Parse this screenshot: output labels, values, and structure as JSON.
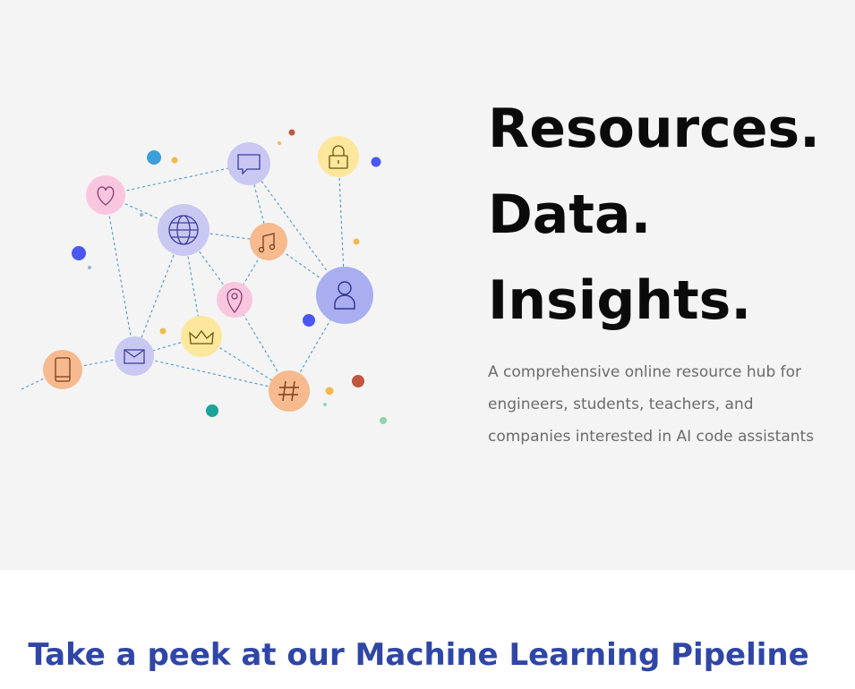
{
  "hero": {
    "headline": [
      "Resources.",
      "Data.",
      "Insights."
    ],
    "description_lines": [
      "A comprehensive online resource hub for",
      "engineers, students, teachers, and",
      "companies interested in AI code assistants"
    ],
    "illustration_icons": [
      "heart-icon",
      "chat-icon",
      "lock-icon",
      "globe-icon",
      "music-icon",
      "user-icon",
      "location-pin-icon",
      "crown-icon",
      "mail-icon",
      "phone-icon",
      "hashtag-icon"
    ]
  },
  "section": {
    "title": "Take a peek at our Machine Learning Pipeline"
  },
  "colors": {
    "hero_bg": "#f4f4f4",
    "headline": "#0b0b0b",
    "description": "#6b6b6b",
    "section_title": "#2f46a6",
    "line": "#3a8fc9",
    "pink": "#f9c6e0",
    "lavender": "#c9c8f2",
    "yellow": "#fde79c",
    "orange": "#f7b98e",
    "blue": "#a8aef0"
  }
}
